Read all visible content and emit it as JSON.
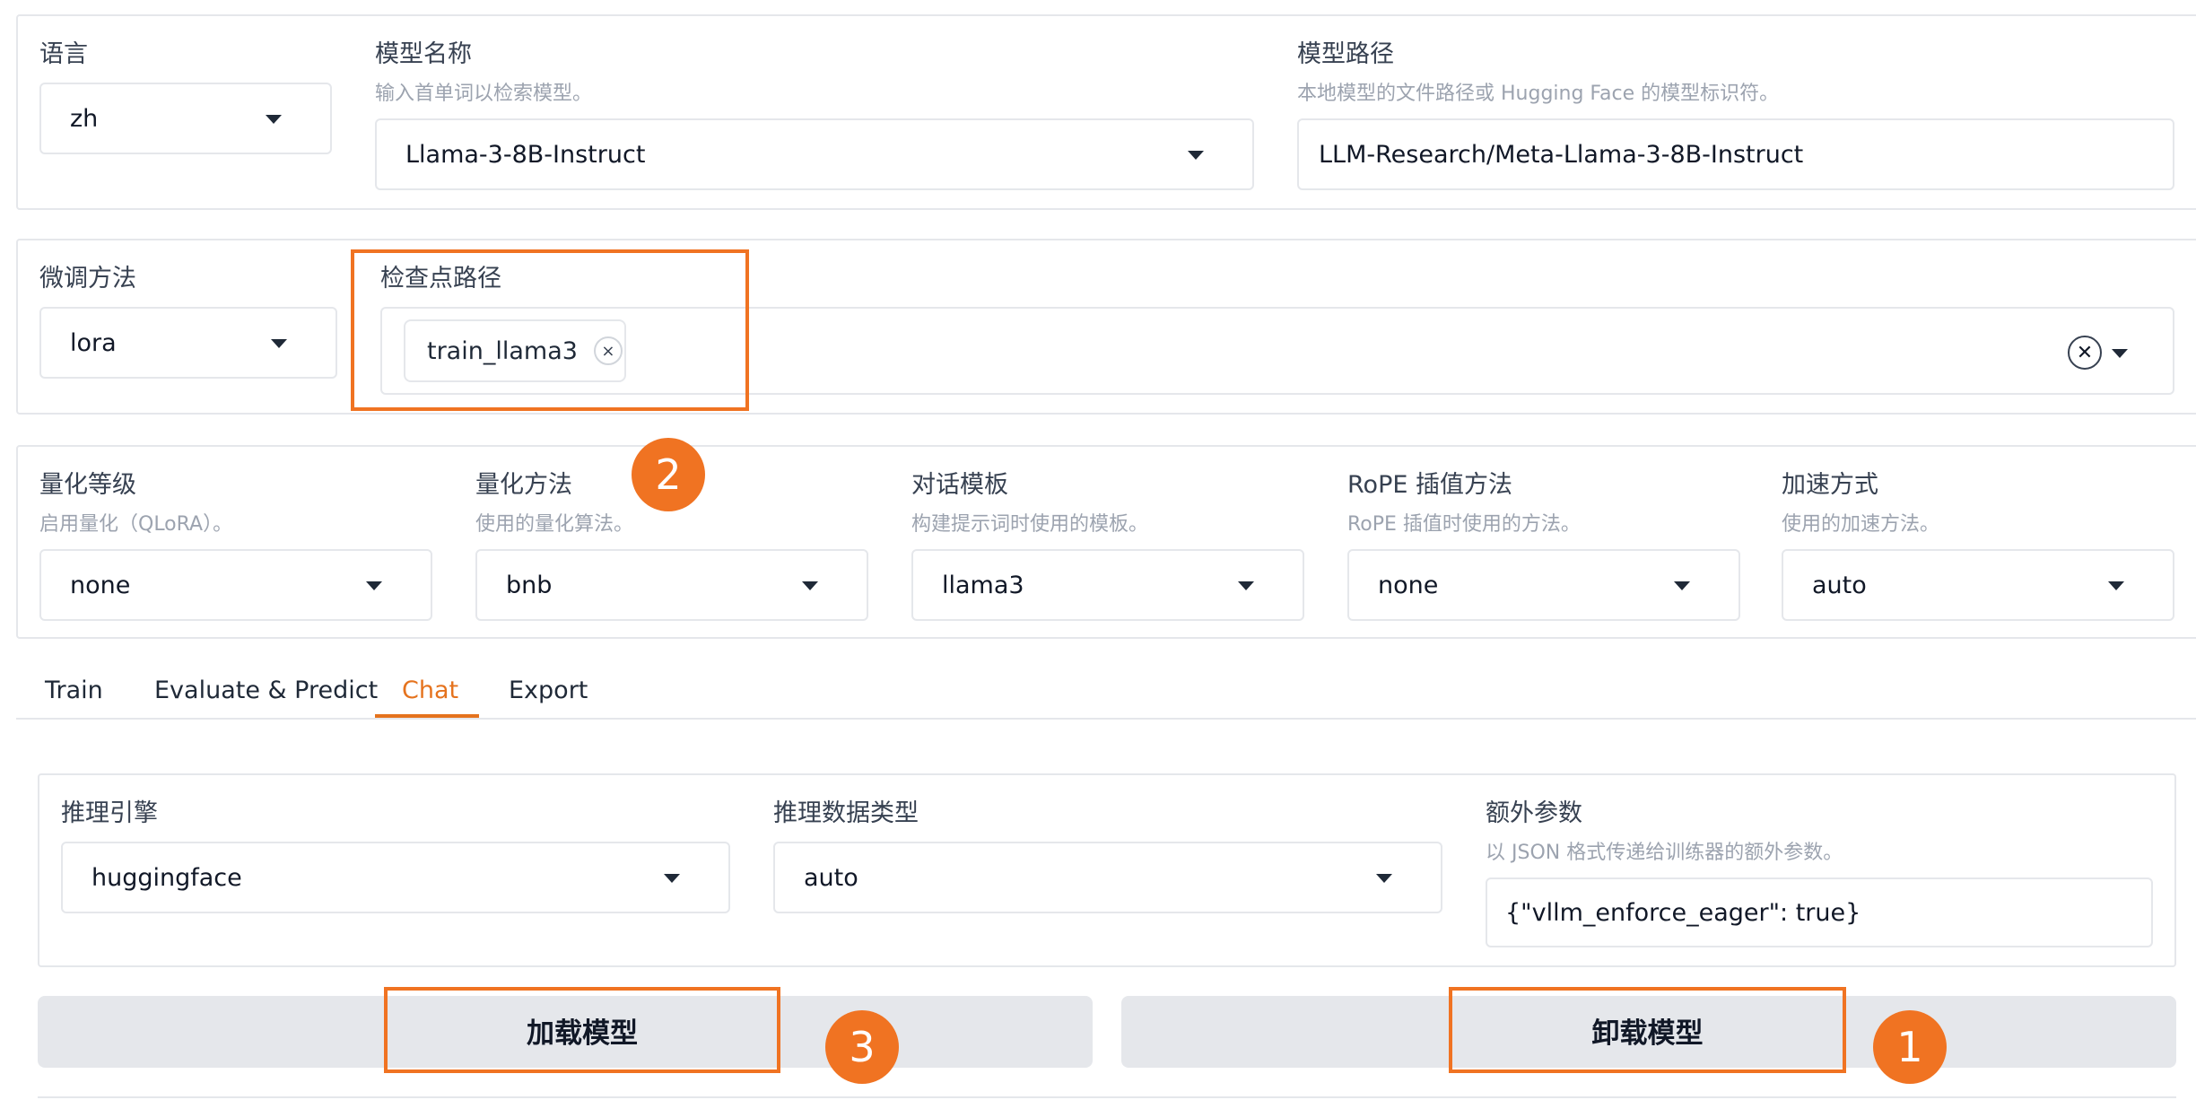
{
  "model": {
    "language": {
      "label": "语言",
      "value": "zh"
    },
    "name": {
      "label": "模型名称",
      "hint": "输入首单词以检索模型。",
      "value": "Llama-3-8B-Instruct"
    },
    "path": {
      "label": "模型路径",
      "hint": "本地模型的文件路径或 Hugging Face 的模型标识符。",
      "value": "LLM-Research/Meta-Llama-3-8B-Instruct"
    }
  },
  "finetune": {
    "method": {
      "label": "微调方法",
      "value": "lora"
    },
    "checkpoint": {
      "label": "检查点路径",
      "chip": "train_llama3",
      "chip_remove": "×",
      "clear": "✕"
    }
  },
  "advanced": {
    "quant_bit": {
      "label": "量化等级",
      "hint": "启用量化（QLoRA）。",
      "value": "none"
    },
    "quant_method": {
      "label": "量化方法",
      "hint": "使用的量化算法。",
      "value": "bnb"
    },
    "template": {
      "label": "对话模板",
      "hint": "构建提示词时使用的模板。",
      "value": "llama3"
    },
    "rope": {
      "label": "RoPE 插值方法",
      "hint": "RoPE 插值时使用的方法。",
      "value": "none"
    },
    "booster": {
      "label": "加速方式",
      "hint": "使用的加速方法。",
      "value": "auto"
    }
  },
  "tabs": [
    {
      "label": "Train",
      "active": false
    },
    {
      "label": "Evaluate & Predict",
      "active": false
    },
    {
      "label": "Chat",
      "active": true
    },
    {
      "label": "Export",
      "active": false
    }
  ],
  "chat": {
    "infer_backend": {
      "label": "推理引擎",
      "value": "huggingface"
    },
    "infer_dtype": {
      "label": "推理数据类型",
      "value": "auto"
    },
    "extra_args": {
      "label": "额外参数",
      "hint": "以 JSON 格式传递给训练器的额外参数。",
      "value": "{\"vllm_enforce_eager\": true}"
    },
    "load_button": "加载模型",
    "unload_button": "卸载模型"
  },
  "annotations": {
    "step1": "1",
    "step2": "2",
    "step3": "3",
    "color": "#f07322"
  },
  "colors": {
    "accent": "#e5731e",
    "button_bg": "#e5e7eb",
    "border": "#e5e7eb"
  }
}
